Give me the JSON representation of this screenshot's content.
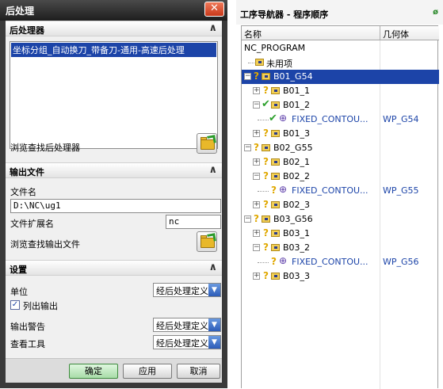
{
  "dialog": {
    "title": "后处理",
    "close_symbol": "✕",
    "postprocessor_section": {
      "header": "后处理器",
      "list_items": [
        "坐标分组_自动换刀_带备刀-通用-高速后处理"
      ],
      "browse_label": "浏览查找后处理器"
    },
    "output_section": {
      "header": "输出文件",
      "filename_label": "文件名",
      "filename_value": "D:\\NC\\ug1",
      "extension_label": "文件扩展名",
      "extension_value": "nc",
      "browse_label": "浏览查找输出文件"
    },
    "settings_section": {
      "header": "设置",
      "unit_label": "单位",
      "unit_value": "经后处理定义",
      "list_output_label": "列出输出",
      "list_output_checked": true,
      "warning_label": "输出警告",
      "warning_value": "经后处理定义",
      "review_label": "查看工具",
      "review_value": "经后处理定义"
    },
    "buttons": {
      "ok": "确定",
      "apply": "应用",
      "cancel": "取消"
    }
  },
  "navigator": {
    "title": "工序导航器 - 程序顺序",
    "col_name": "名称",
    "col_geometry": "几何体",
    "rows": [
      {
        "name": "NC_PROGRAM",
        "geometry": ""
      },
      {
        "name": "未用项",
        "geometry": ""
      },
      {
        "name": "B01_G54",
        "geometry": ""
      },
      {
        "name": "B01_1",
        "geometry": ""
      },
      {
        "name": "B01_2",
        "geometry": ""
      },
      {
        "name": "FIXED_CONTOU...",
        "geometry": "WP_G54"
      },
      {
        "name": "B01_3",
        "geometry": ""
      },
      {
        "name": "B02_G55",
        "geometry": ""
      },
      {
        "name": "B02_1",
        "geometry": ""
      },
      {
        "name": "B02_2",
        "geometry": ""
      },
      {
        "name": "FIXED_CONTOU...",
        "geometry": "WP_G55"
      },
      {
        "name": "B02_3",
        "geometry": ""
      },
      {
        "name": "B03_G56",
        "geometry": ""
      },
      {
        "name": "B03_1",
        "geometry": ""
      },
      {
        "name": "B03_2",
        "geometry": ""
      },
      {
        "name": "FIXED_CONTOU...",
        "geometry": "WP_G56"
      },
      {
        "name": "B03_3",
        "geometry": ""
      }
    ]
  },
  "colors": {
    "selection": "#1c44a8",
    "ok_green": "#a8dca8",
    "key_yellow": "#e0a800",
    "check_green": "#2ca02c"
  }
}
